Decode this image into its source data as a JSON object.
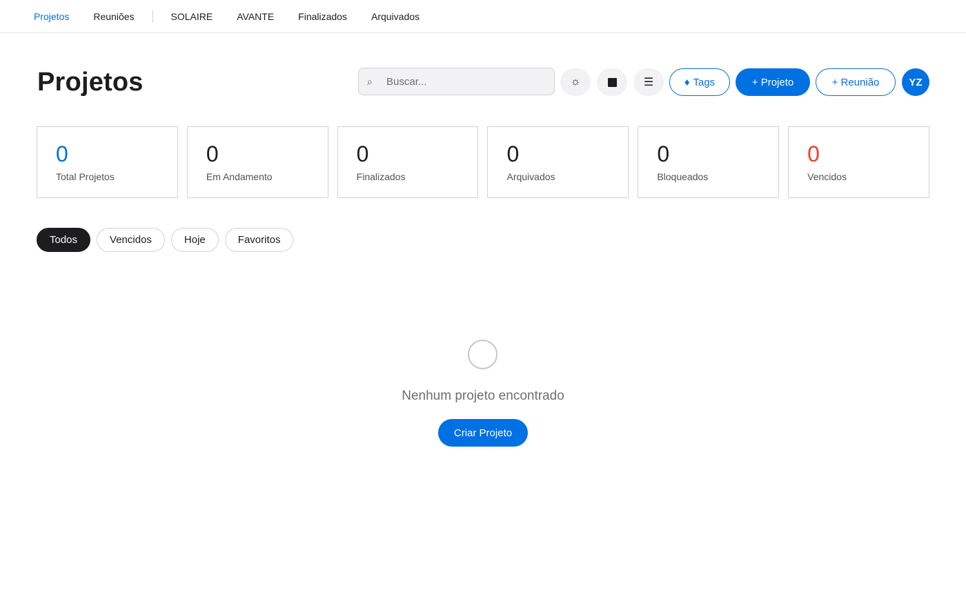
{
  "nav": {
    "items": [
      {
        "label": "Projetos"
      },
      {
        "label": "Reuniões"
      },
      {
        "label": "SOLAIRE"
      },
      {
        "label": "AVANTE"
      },
      {
        "label": "Finalizados"
      },
      {
        "label": "Arquivados"
      }
    ],
    "active": "Projetos"
  },
  "header": {
    "title": "Projetos",
    "search": {
      "placeholder": "Buscar...",
      "value": ""
    },
    "theme_glyph": "☼",
    "list_glyph": "☰",
    "tags_glyph": "♦",
    "tags_label": "Tags",
    "new_project_label": "+ Projeto",
    "new_meeting_label": "+ Reunião",
    "avatar_initials": "YZ",
    "accent_color": "#0071e3"
  },
  "stats": [
    {
      "value": "0",
      "label": "Total Projetos",
      "color": "#0071e3"
    },
    {
      "value": "0",
      "label": "Em Andamento"
    },
    {
      "value": "0",
      "label": "Finalizados"
    },
    {
      "value": "0",
      "label": "Arquivados"
    },
    {
      "value": "0",
      "label": "Bloqueados"
    },
    {
      "value": "0",
      "label": "Vencidos",
      "color": "#e8412f"
    }
  ],
  "filters": [
    {
      "label": "Todos",
      "active": true
    },
    {
      "label": "Vencidos"
    },
    {
      "label": "Hoje"
    },
    {
      "label": "Favoritos"
    }
  ],
  "empty_state": {
    "message": "Nenhum projeto encontrado",
    "cta_label": "Criar Projeto"
  }
}
